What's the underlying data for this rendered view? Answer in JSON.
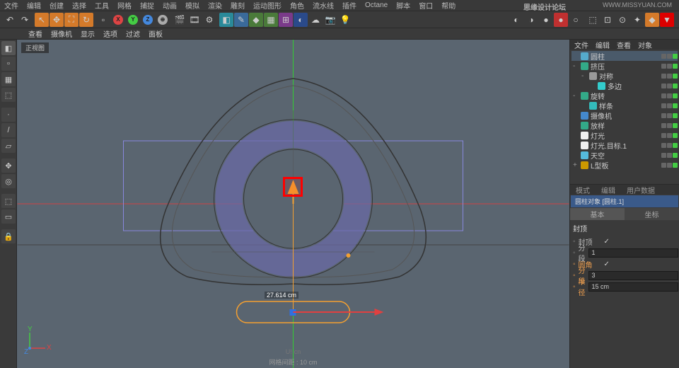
{
  "menus": [
    "文件",
    "编辑",
    "创建",
    "选择",
    "工具",
    "网格",
    "捕捉",
    "动画",
    "模拟",
    "渲染",
    "雕刻",
    "运动图形",
    "角色",
    "流水线",
    "插件",
    "Octane",
    "脚本",
    "窗口",
    "帮助"
  ],
  "subbar_items": [
    "查看",
    "摄像机",
    "显示",
    "选项",
    "过滤",
    "面板"
  ],
  "viewport": {
    "label": "正视图",
    "measurement": "27.614 cm",
    "grid_text": "网格间距 : 10 cm",
    "logo": "U!·cn"
  },
  "objects": [
    {
      "name": "圆柱",
      "indent": 0,
      "color": "#5ac",
      "hl": true
    },
    {
      "name": "挤压",
      "indent": 0,
      "color": "#3a8",
      "exp": "-"
    },
    {
      "name": "对称",
      "indent": 1,
      "color": "#999",
      "exp": "-"
    },
    {
      "name": "多边",
      "indent": 2,
      "color": "#3cc"
    },
    {
      "name": "旋转",
      "indent": 0,
      "color": "#3a8",
      "exp": "-"
    },
    {
      "name": "样条",
      "indent": 1,
      "color": "#3bb"
    },
    {
      "name": "摄像机",
      "indent": 0,
      "color": "#48c"
    },
    {
      "name": "放样",
      "indent": 0,
      "color": "#3a8"
    },
    {
      "name": "灯光",
      "indent": 0,
      "color": "#eee"
    },
    {
      "name": "灯光.目标.1",
      "indent": 0,
      "color": "#eee"
    },
    {
      "name": "天空",
      "indent": 0,
      "color": "#5bd"
    },
    {
      "name": "L型板",
      "indent": 0,
      "color": "#c90",
      "exp": "+"
    }
  ],
  "attr": {
    "tabs": [
      "模式",
      "编辑",
      "用户数据"
    ],
    "title": "圆柱对象 [圆柱.1]",
    "subtabs": [
      "基本",
      "坐标"
    ],
    "section": "封顶",
    "rows": [
      {
        "label": "封顶",
        "type": "check",
        "checked": true
      },
      {
        "label": "分段",
        "type": "num",
        "value": "1"
      },
      {
        "label": "圆角",
        "type": "check",
        "checked": true,
        "hl": true
      },
      {
        "label": "分段",
        "type": "num",
        "value": "3",
        "hl": true
      },
      {
        "label": "半径",
        "type": "num",
        "value": "15 cm",
        "hl": true
      }
    ]
  },
  "tree_header": [
    "文件",
    "编辑",
    "查看",
    "对象"
  ],
  "watermark": "思缘设计论坛",
  "watermark_url": "WWW.MISSYUAN.COM"
}
